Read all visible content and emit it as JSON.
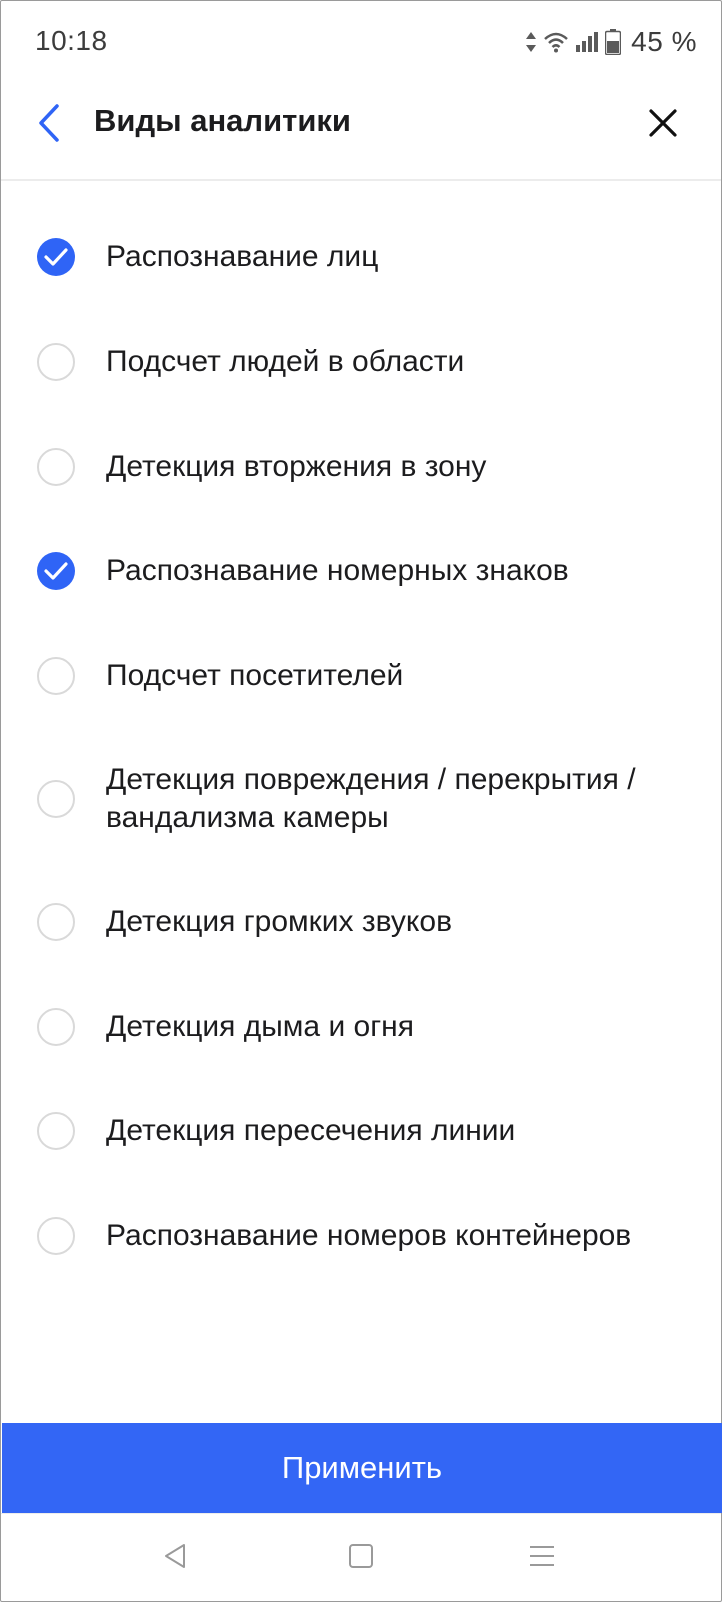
{
  "status_bar": {
    "time": "10:18",
    "battery": "45 %",
    "icons": [
      "data-arrows-icon",
      "wifi-icon",
      "signal-icon",
      "battery-icon"
    ]
  },
  "header": {
    "title": "Виды аналитики",
    "back_icon": "chevron-left-icon",
    "close_icon": "close-icon"
  },
  "colors": {
    "accent": "#3366f5",
    "checked": "#2f64f6",
    "unchecked_border": "#d9d9d9",
    "text": "#1c1c1e"
  },
  "options": [
    {
      "label": "Распознавание лиц",
      "checked": true
    },
    {
      "label": "Подсчет людей в области",
      "checked": false
    },
    {
      "label": "Детекция вторжения в зону",
      "checked": false
    },
    {
      "label": "Распознавание номерных знаков",
      "checked": true
    },
    {
      "label": "Подсчет посетителей",
      "checked": false
    },
    {
      "label": "Детекция повреждения / перекрытия / вандализма камеры",
      "checked": false
    },
    {
      "label": "Детекция громких звуков",
      "checked": false
    },
    {
      "label": "Детекция дыма и огня",
      "checked": false
    },
    {
      "label": "Детекция пересечения линии",
      "checked": false
    },
    {
      "label": "Распознавание номеров контейнеров",
      "checked": false
    }
  ],
  "apply_button": {
    "label": "Применить"
  },
  "nav_bar": {
    "icons": [
      "nav-back-icon",
      "nav-home-icon",
      "nav-menu-icon"
    ]
  }
}
